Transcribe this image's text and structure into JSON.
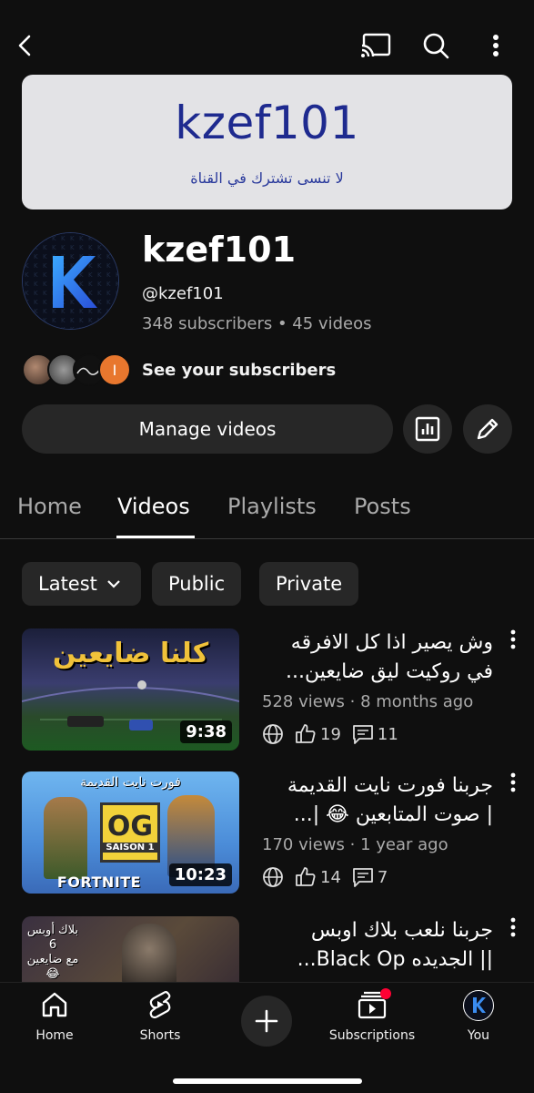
{
  "banner": {
    "title": "kzef101",
    "subtitle": "لا تنسى تشترك في القناة"
  },
  "channel": {
    "name": "kzef101",
    "handle": "@kzef101",
    "meta": "348 subscribers • 45 videos",
    "avatar_letter": "K",
    "see_subscribers": "See your subscribers",
    "sub_avatar_letter": "I"
  },
  "actions": {
    "manage_videos": "Manage videos"
  },
  "tabs": [
    {
      "label": "Home"
    },
    {
      "label": "Videos"
    },
    {
      "label": "Playlists"
    },
    {
      "label": "Posts"
    }
  ],
  "filters": {
    "latest": "Latest",
    "public": "Public",
    "private": "Private"
  },
  "videos": [
    {
      "title": "وش يصير  اذا كل الافرقه\nفي روكيت ليق ضايعين...",
      "meta": "528 views · 8 months ago",
      "likes": "19",
      "comments": "11",
      "duration": "9:38",
      "thumb_text": "كلنا ضايعين"
    },
    {
      "title": "جربنا فورت نايت القديمة\n| صوت المتابعين 😂 |...",
      "meta": "170 views · 1 year ago",
      "likes": "14",
      "comments": "7",
      "duration": "10:23",
      "thumb_top": "فورت نايت القديمة",
      "thumb_og": "OG",
      "thumb_season": "SAISON 1",
      "thumb_brand": "FORTNITE"
    },
    {
      "title": "جربنا نلعب بلاك اوبس\n|| الجديده Black Op...",
      "thumb_text": "بلاك أوبس 6\nمع ضايعين 😂"
    }
  ],
  "nav": {
    "home": "Home",
    "shorts": "Shorts",
    "subscriptions": "Subscriptions",
    "you": "You"
  },
  "colors": {
    "accent_red": "#ff0033",
    "brand_blue": "#2f6fe0",
    "banner_title": "#1e2a8f"
  }
}
